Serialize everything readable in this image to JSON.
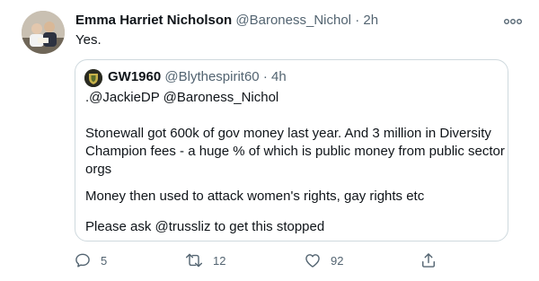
{
  "tweet": {
    "author_name": "Emma Harriet Nicholson",
    "author_handle": "@Baroness_Nichol",
    "separator": "·",
    "time": "2h",
    "text": "Yes."
  },
  "quoted": {
    "author_name": "GW1960",
    "author_handle": "@Blythespirit60",
    "separator": "·",
    "time": "4h",
    "lines": [
      ".@JackieDP @Baroness_Nichol",
      "Stonewall got 600k of gov money last year.  And 3 million in Diversity",
      "Champion fees - a huge % of which is public money from public sector",
      "orgs",
      "Money then used to attack women's rights, gay rights etc",
      "Please ask @trussliz to get this stopped"
    ]
  },
  "actions": {
    "reply_count": "5",
    "retweet_count": "12",
    "like_count": "92"
  },
  "icons": {
    "more": "more-horizontal-icon",
    "reply": "reply-icon",
    "retweet": "retweet-icon",
    "like": "heart-icon",
    "share": "share-icon"
  },
  "colors": {
    "text": "#0f1419",
    "muted": "#536471",
    "border": "#cfd9de"
  }
}
